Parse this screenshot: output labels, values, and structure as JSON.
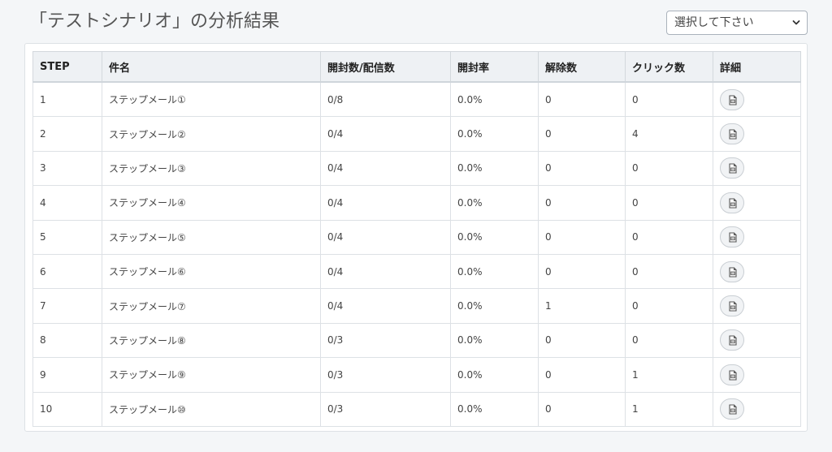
{
  "header": {
    "title": "「テストシナリオ」の分析結果",
    "select_value": "選択して下さい"
  },
  "table": {
    "columns": [
      "STEP",
      "件名",
      "開封数/配信数",
      "開封率",
      "解除数",
      "クリック数",
      "詳細"
    ],
    "rows": [
      {
        "step": "1",
        "subject": "ステップメール①",
        "opened": "0/8",
        "rate": "0.0%",
        "unsub": "0",
        "clicks": "0"
      },
      {
        "step": "2",
        "subject": "ステップメール②",
        "opened": "0/4",
        "rate": "0.0%",
        "unsub": "0",
        "clicks": "4"
      },
      {
        "step": "3",
        "subject": "ステップメール③",
        "opened": "0/4",
        "rate": "0.0%",
        "unsub": "0",
        "clicks": "0"
      },
      {
        "step": "4",
        "subject": "ステップメール④",
        "opened": "0/4",
        "rate": "0.0%",
        "unsub": "0",
        "clicks": "0"
      },
      {
        "step": "5",
        "subject": "ステップメール⑤",
        "opened": "0/4",
        "rate": "0.0%",
        "unsub": "0",
        "clicks": "0"
      },
      {
        "step": "6",
        "subject": "ステップメール⑥",
        "opened": "0/4",
        "rate": "0.0%",
        "unsub": "0",
        "clicks": "0"
      },
      {
        "step": "7",
        "subject": "ステップメール⑦",
        "opened": "0/4",
        "rate": "0.0%",
        "unsub": "1",
        "clicks": "0"
      },
      {
        "step": "8",
        "subject": "ステップメール⑧",
        "opened": "0/3",
        "rate": "0.0%",
        "unsub": "0",
        "clicks": "0"
      },
      {
        "step": "9",
        "subject": "ステップメール⑨",
        "opened": "0/3",
        "rate": "0.0%",
        "unsub": "0",
        "clicks": "1"
      },
      {
        "step": "10",
        "subject": "ステップメール⑩",
        "opened": "0/3",
        "rate": "0.0%",
        "unsub": "0",
        "clicks": "1"
      }
    ]
  },
  "icons": {
    "detail": "document-icon",
    "select": "chevron-down-icon"
  }
}
